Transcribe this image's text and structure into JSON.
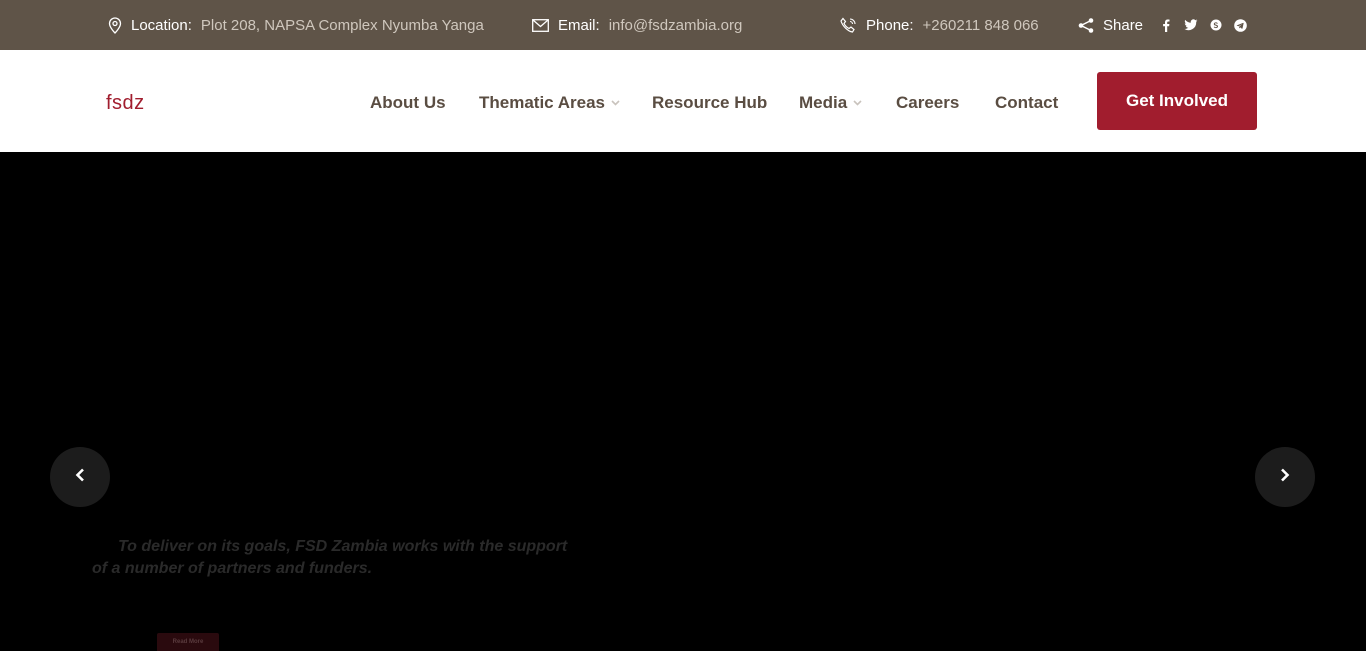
{
  "topbar": {
    "location_label": "Location:",
    "location_value": "Plot 208, NAPSA Complex Nyumba Yanga",
    "email_label": "Email:",
    "email_value": "info@fsdzambia.org",
    "phone_label": "Phone:",
    "phone_value": "+260211 848 066",
    "share_label": "Share",
    "social_icons": [
      "facebook-icon",
      "twitter-icon",
      "skype-icon",
      "telegram-icon"
    ]
  },
  "header": {
    "logo_text": "fsdz",
    "nav": [
      {
        "label": "About Us",
        "has_dropdown": false
      },
      {
        "label": "Thematic Areas",
        "has_dropdown": true
      },
      {
        "label": "Resource Hub",
        "has_dropdown": false
      },
      {
        "label": "Media",
        "has_dropdown": true
      },
      {
        "label": "Careers",
        "has_dropdown": false
      },
      {
        "label": "Contact",
        "has_dropdown": false
      }
    ],
    "cta_label": "Get Involved"
  },
  "hero": {
    "caption_line1": "To deliver on its goals, FSD Zambia works with the support",
    "caption_line2": "of a number of partners and funders.",
    "read_more_label": "Read More"
  },
  "colors": {
    "topbar_bg": "#5f5448",
    "brand_red": "#a11d2e",
    "nav_text": "#5a4d42",
    "hero_bg": "#000000"
  }
}
